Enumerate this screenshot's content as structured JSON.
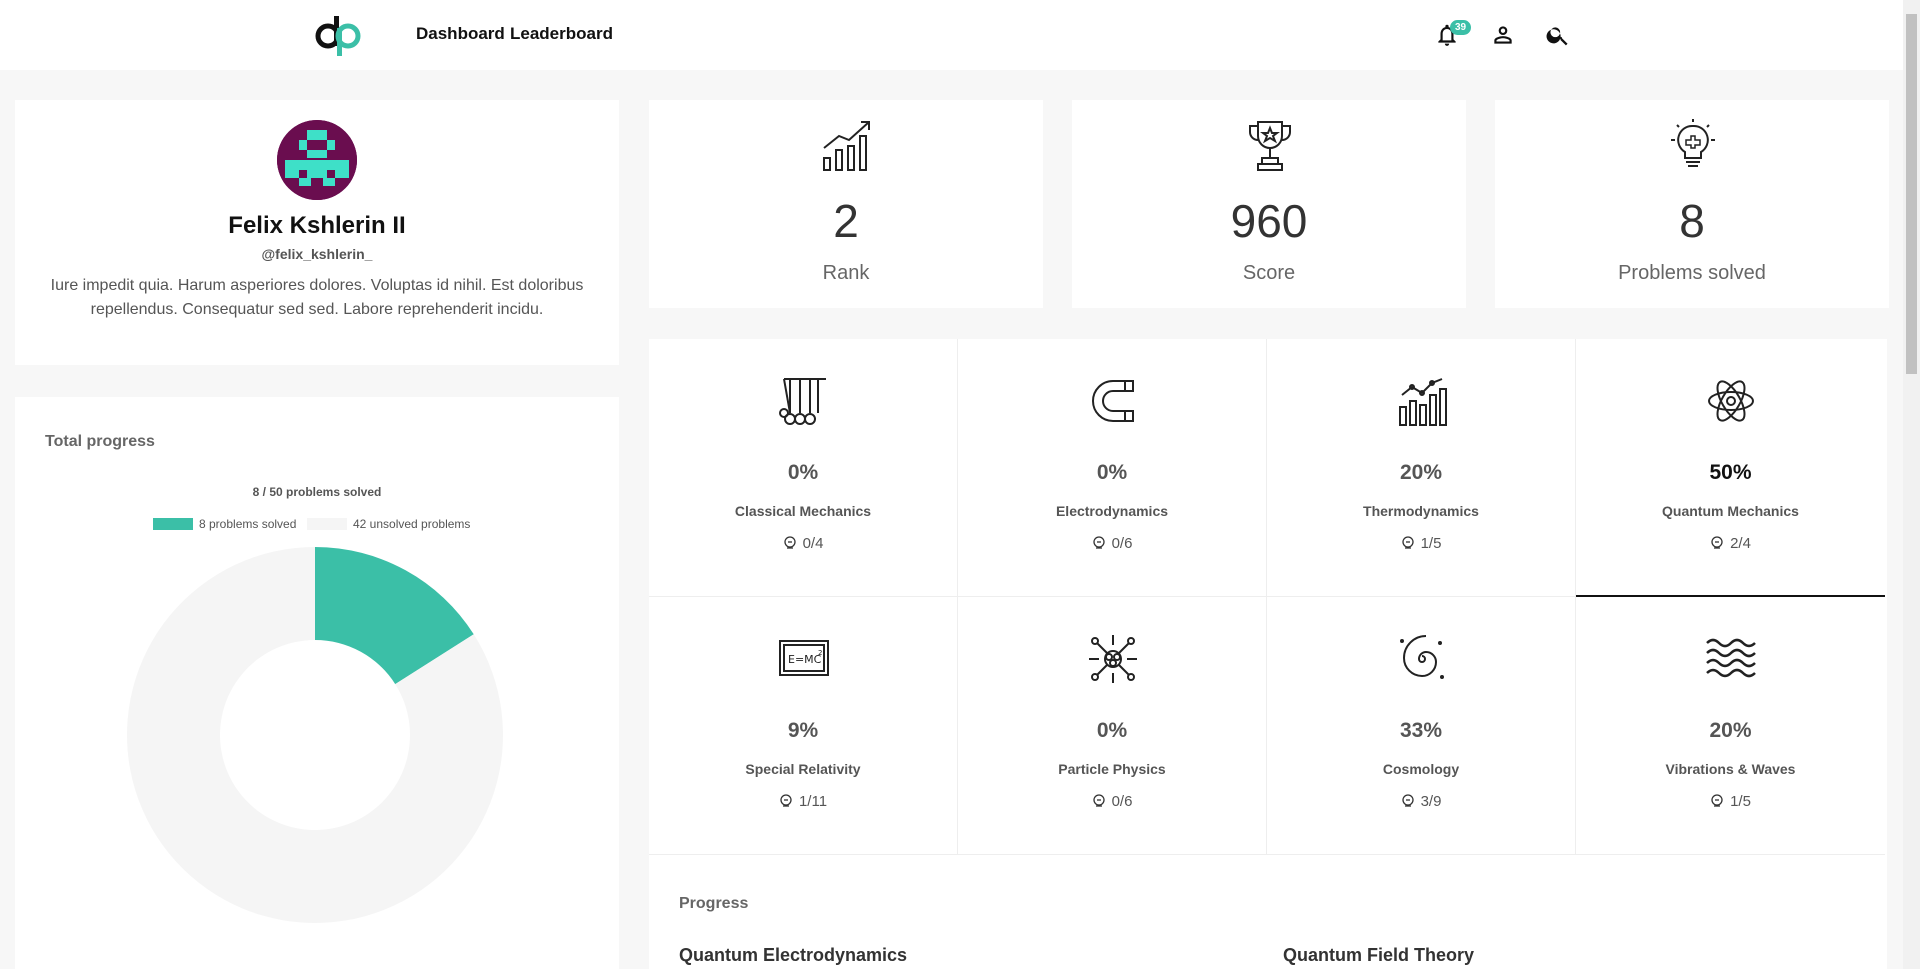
{
  "nav": {
    "links": [
      "Dashboard",
      "Leaderboard"
    ],
    "notification_count": "39",
    "icons": [
      "bell-icon",
      "user-icon",
      "search-icon"
    ]
  },
  "profile": {
    "name": "Felix Kshlerin II",
    "handle": "@felix_kshlerin_",
    "bio": "Iure impedit quia. Harum asperiores dolores. Voluptas id nihil. Est doloribus repellendus. Consequatur sed sed. Labore reprehenderit incidu."
  },
  "total_progress": {
    "title": "Total progress",
    "chart_title": "8 / 50 problems solved",
    "legend_solved": "8 problems solved",
    "legend_unsolved": "42 unsolved problems",
    "colors": {
      "solved": "#3bbfa7",
      "unsolved": "#f5f5f5"
    }
  },
  "chart_data": {
    "type": "pie",
    "categories": [
      "8 problems solved",
      "42 unsolved problems"
    ],
    "values": [
      8,
      42
    ],
    "title": "8 / 50 problems solved"
  },
  "stats": {
    "rank": {
      "value": "2",
      "label": "Rank"
    },
    "score": {
      "value": "960",
      "label": "Score"
    },
    "solved": {
      "value": "8",
      "label": "Problems solved"
    }
  },
  "topics": [
    {
      "name": "Classical Mechanics",
      "percent": "0%",
      "count": "0/4",
      "icon": "pendulum-icon"
    },
    {
      "name": "Electrodynamics",
      "percent": "0%",
      "count": "0/6",
      "icon": "magnet-icon"
    },
    {
      "name": "Thermodynamics",
      "percent": "20%",
      "count": "1/5",
      "icon": "chart-icon"
    },
    {
      "name": "Quantum Mechanics",
      "percent": "50%",
      "count": "2/4",
      "icon": "atom-icon"
    },
    {
      "name": "Special Relativity",
      "percent": "9%",
      "count": "1/11",
      "icon": "emc2-icon"
    },
    {
      "name": "Particle Physics",
      "percent": "0%",
      "count": "0/6",
      "icon": "particle-icon"
    },
    {
      "name": "Cosmology",
      "percent": "33%",
      "count": "3/9",
      "icon": "galaxy-icon"
    },
    {
      "name": "Vibrations & Waves",
      "percent": "20%",
      "count": "1/5",
      "icon": "waves-icon"
    }
  ],
  "progress_section": {
    "title": "Progress",
    "courses": [
      "Quantum Electrodynamics",
      "Quantum Field Theory"
    ]
  }
}
